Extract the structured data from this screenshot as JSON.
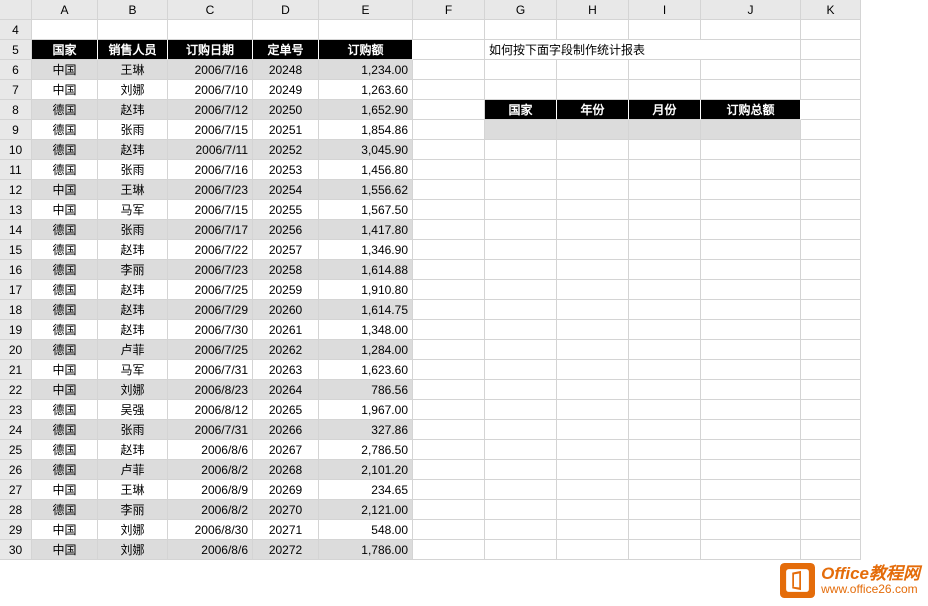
{
  "columns": [
    "A",
    "B",
    "C",
    "D",
    "E",
    "F",
    "G",
    "H",
    "I",
    "J",
    "K"
  ],
  "startRow": 4,
  "left_headers": [
    "国家",
    "销售人员",
    "订购日期",
    "定单号",
    "订购额"
  ],
  "right_headers": [
    "国家",
    "年份",
    "月份",
    "订购总额"
  ],
  "note": "如何按下面字段制作统计报表",
  "rows": [
    {
      "a": "中国",
      "b": "王琳",
      "c": "2006/7/16",
      "d": "20248",
      "e": "1,234.00"
    },
    {
      "a": "中国",
      "b": "刘娜",
      "c": "2006/7/10",
      "d": "20249",
      "e": "1,263.60"
    },
    {
      "a": "德国",
      "b": "赵玮",
      "c": "2006/7/12",
      "d": "20250",
      "e": "1,652.90"
    },
    {
      "a": "德国",
      "b": "张雨",
      "c": "2006/7/15",
      "d": "20251",
      "e": "1,854.86"
    },
    {
      "a": "德国",
      "b": "赵玮",
      "c": "2006/7/11",
      "d": "20252",
      "e": "3,045.90"
    },
    {
      "a": "德国",
      "b": "张雨",
      "c": "2006/7/16",
      "d": "20253",
      "e": "1,456.80"
    },
    {
      "a": "中国",
      "b": "王琳",
      "c": "2006/7/23",
      "d": "20254",
      "e": "1,556.62"
    },
    {
      "a": "中国",
      "b": "马军",
      "c": "2006/7/15",
      "d": "20255",
      "e": "1,567.50"
    },
    {
      "a": "德国",
      "b": "张雨",
      "c": "2006/7/17",
      "d": "20256",
      "e": "1,417.80"
    },
    {
      "a": "德国",
      "b": "赵玮",
      "c": "2006/7/22",
      "d": "20257",
      "e": "1,346.90"
    },
    {
      "a": "德国",
      "b": "李丽",
      "c": "2006/7/23",
      "d": "20258",
      "e": "1,614.88"
    },
    {
      "a": "德国",
      "b": "赵玮",
      "c": "2006/7/25",
      "d": "20259",
      "e": "1,910.80"
    },
    {
      "a": "德国",
      "b": "赵玮",
      "c": "2006/7/29",
      "d": "20260",
      "e": "1,614.75"
    },
    {
      "a": "德国",
      "b": "赵玮",
      "c": "2006/7/30",
      "d": "20261",
      "e": "1,348.00"
    },
    {
      "a": "德国",
      "b": "卢菲",
      "c": "2006/7/25",
      "d": "20262",
      "e": "1,284.00"
    },
    {
      "a": "中国",
      "b": "马军",
      "c": "2006/7/31",
      "d": "20263",
      "e": "1,623.60"
    },
    {
      "a": "中国",
      "b": "刘娜",
      "c": "2006/8/23",
      "d": "20264",
      "e": "786.56"
    },
    {
      "a": "德国",
      "b": "吴强",
      "c": "2006/8/12",
      "d": "20265",
      "e": "1,967.00"
    },
    {
      "a": "德国",
      "b": "张雨",
      "c": "2006/7/31",
      "d": "20266",
      "e": "327.86"
    },
    {
      "a": "德国",
      "b": "赵玮",
      "c": "2006/8/6",
      "d": "20267",
      "e": "2,786.50"
    },
    {
      "a": "德国",
      "b": "卢菲",
      "c": "2006/8/2",
      "d": "20268",
      "e": "2,101.20"
    },
    {
      "a": "中国",
      "b": "王琳",
      "c": "2006/8/9",
      "d": "20269",
      "e": "234.65"
    },
    {
      "a": "德国",
      "b": "李丽",
      "c": "2006/8/2",
      "d": "20270",
      "e": "2,121.00"
    },
    {
      "a": "中国",
      "b": "刘娜",
      "c": "2006/8/30",
      "d": "20271",
      "e": "548.00"
    },
    {
      "a": "中国",
      "b": "刘娜",
      "c": "2006/8/6",
      "d": "20272",
      "e": "1,786.00"
    }
  ],
  "watermark": {
    "title": "Office教程网",
    "url": "www.office26.com"
  }
}
